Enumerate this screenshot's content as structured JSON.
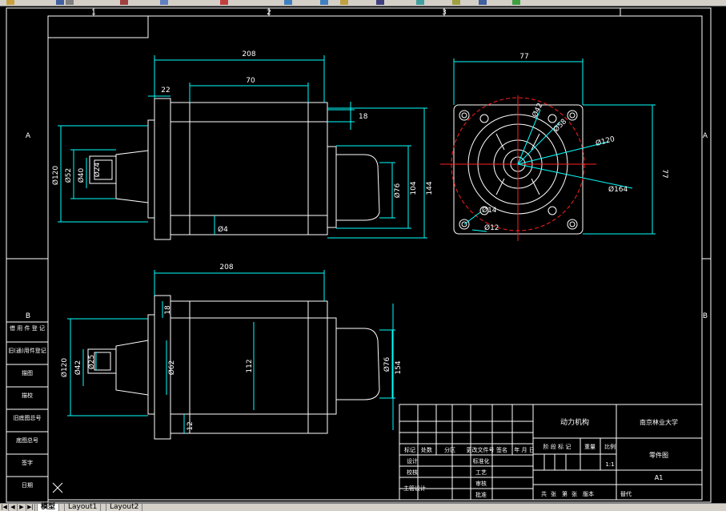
{
  "toolbar": {
    "icons": [
      "open-icon",
      "save-icon",
      "print-icon",
      "cut-icon",
      "copy-icon",
      "paste-icon",
      "undo-icon",
      "redo-icon",
      "pan-icon",
      "zoom-icon",
      "properties-icon",
      "layers-icon",
      "calculator-icon",
      "help-icon"
    ]
  },
  "drawing": {
    "zone_columns": [
      "1",
      "2",
      "3"
    ],
    "zone_rows": [
      "A",
      "B"
    ],
    "front_view": {
      "dims": {
        "overall_length": "208",
        "flange": "22",
        "body": "70",
        "right_step": "18",
        "d_outer": "Ø120",
        "d_shaft_hub": "Ø52",
        "d_40": "Ø40",
        "d_24": "Ø24",
        "d_bottom": "Ø4",
        "d_76": "Ø76",
        "h_104": "104",
        "h_144": "144"
      }
    },
    "end_view": {
      "dims": {
        "width": "77",
        "height": "77",
        "d_42": "Ø42",
        "d_58": "Ø58",
        "d_120": "Ø120",
        "d_164": "Ø164",
        "d_14": "Ø14",
        "d_12": "Ø12"
      }
    },
    "bottom_view": {
      "dims": {
        "overall_length": "208",
        "left_step": "18",
        "d_outer": "Ø120",
        "d_42": "Ø42",
        "d_25": "Ø25",
        "d_62": "Ø62",
        "h_112": "112",
        "d_76": "Ø76",
        "h_154": "154",
        "bottom_step": "12"
      }
    },
    "left_table": {
      "rows": [
        "借 用 件 登 记",
        "旧(通)用件登记",
        "描图",
        "描校",
        "旧底图总号",
        "底图总号",
        "签字",
        "日期"
      ]
    },
    "title_block": {
      "part_name": "动力机构",
      "school": "南京林业大学",
      "drawing_type": "零件图",
      "sheet_size": "A1",
      "scale": "1:1",
      "headers": [
        "标记",
        "处数",
        "分区",
        "更改文件号",
        "签名",
        "年 月 日"
      ],
      "roles": [
        "设计",
        "校核",
        "主管设计",
        "标准化",
        "工艺",
        "审核",
        "批准"
      ],
      "stage_headers": [
        "阶 段 标 记",
        "重量",
        "比例"
      ],
      "footer": [
        "共",
        "张",
        "第",
        "张",
        "版本",
        "替代"
      ]
    }
  },
  "tabs": {
    "items": [
      "模型",
      "Layout1",
      "Layout2"
    ],
    "active": "模型"
  }
}
